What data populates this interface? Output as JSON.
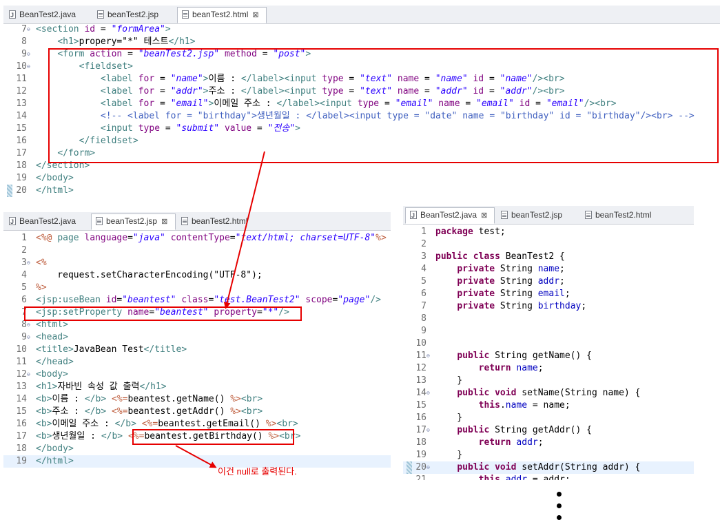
{
  "top_pane": {
    "tabs": [
      {
        "label": "BeanTest2.java",
        "icon": "java-file-icon",
        "active": false
      },
      {
        "label": "beanTest2.jsp",
        "icon": "jsp-file-icon",
        "active": false
      },
      {
        "label": "beanTest2.html",
        "icon": "html-file-icon",
        "active": true
      }
    ],
    "lines": [
      {
        "n": "7",
        "fold": "⊖",
        "html": "<span class='tag'>&lt;section</span> <span class='attr'>id</span> = <span class='str'>\"formArea\"</span><span class='tag'>&gt;</span>"
      },
      {
        "n": "8",
        "html": "    <span class='tag'>&lt;h1&gt;</span>propery=\"*\" 테스트<span class='tag'>&lt;/h1&gt;</span>"
      },
      {
        "n": "9",
        "fold": "⊖",
        "html": "    <span class='tag'>&lt;form</span> <span class='attr'>action</span> = <span class='str'>\"beanTest2.jsp\"</span> <span class='attr'>method</span> = <span class='str'>\"post\"</span><span class='tag'>&gt;</span>"
      },
      {
        "n": "10",
        "fold": "⊖",
        "html": "        <span class='tag'>&lt;fieldset&gt;</span>"
      },
      {
        "n": "11",
        "html": "            <span class='tag'>&lt;label</span> <span class='attr'>for</span> = <span class='str'>\"name\"</span><span class='tag'>&gt;</span>이름 : <span class='tag'>&lt;/label&gt;&lt;input</span> <span class='attr'>type</span> = <span class='str'>\"text\"</span> <span class='attr'>name</span> = <span class='str'>\"name\"</span> <span class='attr'>id</span> = <span class='str'>\"name\"</span><span class='tag'>/&gt;&lt;br&gt;</span>"
      },
      {
        "n": "12",
        "html": "            <span class='tag'>&lt;label</span> <span class='attr'>for</span> = <span class='str'>\"addr\"</span><span class='tag'>&gt;</span>주소 : <span class='tag'>&lt;/label&gt;&lt;input</span> <span class='attr'>type</span> = <span class='str'>\"text\"</span> <span class='attr'>name</span> = <span class='str'>\"addr\"</span> <span class='attr'>id</span> = <span class='str'>\"addr\"</span><span class='tag'>/&gt;&lt;br&gt;</span>"
      },
      {
        "n": "13",
        "html": "            <span class='tag'>&lt;label</span> <span class='attr'>for</span> = <span class='str'>\"email\"</span><span class='tag'>&gt;</span>이메일 주소 : <span class='tag'>&lt;/label&gt;&lt;input</span> <span class='attr'>type</span> = <span class='str'>\"email\"</span> <span class='attr'>name</span> = <span class='str'>\"email\"</span> <span class='attr'>id</span> = <span class='str'>\"email\"</span><span class='tag'>/&gt;&lt;br&gt;</span>"
      },
      {
        "n": "14",
        "html": "            <span class='cmt'>&lt;!-- &lt;label for = \"birthday\"&gt;생년월일 : &lt;/label&gt;&lt;input type = \"date\" name = \"birthday\" id = \"birthday\"/&gt;&lt;br&gt; --&gt;</span>"
      },
      {
        "n": "15",
        "html": "            <span class='tag'>&lt;input</span> <span class='attr'>type</span> = <span class='str'>\"submit\"</span> <span class='attr'>value</span> = <span class='str'>\"전송\"</span><span class='tag'>&gt;</span>"
      },
      {
        "n": "16",
        "html": "        <span class='tag'>&lt;/fieldset&gt;</span>"
      },
      {
        "n": "17",
        "html": "    <span class='tag'>&lt;/form&gt;</span>"
      },
      {
        "n": "18",
        "html": "<span class='tag'>&lt;/section&gt;</span>"
      },
      {
        "n": "19",
        "html": "<span class='tag'>&lt;/body&gt;</span>"
      },
      {
        "n": "20",
        "marker": true,
        "html": "<span class='tag'>&lt;/html&gt;</span>"
      }
    ]
  },
  "jsp_pane": {
    "tabs": [
      {
        "label": "BeanTest2.java",
        "icon": "java-file-icon",
        "active": false
      },
      {
        "label": "beanTest2.jsp",
        "icon": "jsp-file-icon",
        "active": true
      },
      {
        "label": "beanTest2.html",
        "icon": "html-file-icon",
        "active": false
      }
    ],
    "lines": [
      {
        "n": "1",
        "html": "<span class='jsp'>&lt;%@</span> <span class='tag'>page</span> <span class='attr'>language</span>=<span class='str'>\"java\"</span> <span class='attr'>contentType</span>=<span class='str'>\"text/html; charset=UTF-8\"</span><span class='jsp'>%&gt;</span>"
      },
      {
        "n": "2",
        "html": ""
      },
      {
        "n": "3",
        "fold": "⊖",
        "html": "<span class='jsp'>&lt;%</span>"
      },
      {
        "n": "4",
        "html": "    request.setCharacterEncoding(\"UTF-8\");"
      },
      {
        "n": "5",
        "html": "<span class='jsp'>%&gt;</span>"
      },
      {
        "n": "6",
        "html": "<span class='tag'>&lt;jsp:useBean</span> <span class='attr'>id</span>=<span class='str'>\"beantest\"</span> <span class='attr'>class</span>=<span class='str'>\"test.BeanTest2\"</span> <span class='attr'>scope</span>=<span class='str'>\"page\"</span><span class='tag'>/&gt;</span>"
      },
      {
        "n": "7",
        "html": "<span class='tag'>&lt;jsp:setProperty</span> <span class='attr'>name</span>=<span class='str'>\"beantest\"</span> <span class='attr'>property</span>=<span class='str'>\"*\"</span><span class='tag'>/&gt;</span>"
      },
      {
        "n": "8",
        "fold": "⊖",
        "html": "<span class='tag'>&lt;html&gt;</span>"
      },
      {
        "n": "9",
        "fold": "⊖",
        "html": "<span class='tag'>&lt;head&gt;</span>"
      },
      {
        "n": "10",
        "html": "<span class='tag'>&lt;title&gt;</span>JavaBean Test<span class='tag'>&lt;/title&gt;</span>"
      },
      {
        "n": "11",
        "html": "<span class='tag'>&lt;/head&gt;</span>"
      },
      {
        "n": "12",
        "fold": "⊖",
        "html": "<span class='tag'>&lt;body&gt;</span>"
      },
      {
        "n": "13",
        "html": "<span class='tag'>&lt;h1&gt;</span>자바빈 속성 값 출력<span class='tag'>&lt;/h1&gt;</span>"
      },
      {
        "n": "14",
        "html": "<span class='tag'>&lt;b&gt;</span>이름 : <span class='tag'>&lt;/b&gt;</span> <span class='jsp'>&lt;%=</span>beantest.getName() <span class='jsp'>%&gt;</span><span class='tag'>&lt;br&gt;</span>"
      },
      {
        "n": "15",
        "html": "<span class='tag'>&lt;b&gt;</span>주소 : <span class='tag'>&lt;/b&gt;</span> <span class='jsp'>&lt;%=</span>beantest.getAddr() <span class='jsp'>%&gt;</span><span class='tag'>&lt;br&gt;</span>"
      },
      {
        "n": "16",
        "html": "<span class='tag'>&lt;b&gt;</span>이메일 주소 : <span class='tag'>&lt;/b&gt;</span> <span class='jsp'>&lt;%=</span>beantest.getEmail() <span class='jsp'>%&gt;</span><span class='tag'>&lt;br&gt;</span>"
      },
      {
        "n": "17",
        "html": "<span class='tag'>&lt;b&gt;</span>생년월일 : <span class='tag'>&lt;/b&gt;</span> <span class='jsp'>&lt;%=</span>beantest.getBirthday() <span class='jsp'>%&gt;</span><span class='tag'>&lt;br&gt;</span>"
      },
      {
        "n": "18",
        "html": "<span class='tag'>&lt;/body&gt;</span>"
      },
      {
        "n": "19",
        "hl": true,
        "html": "<span class='tag'>&lt;/html&gt;</span>"
      }
    ]
  },
  "java_pane": {
    "tabs": [
      {
        "label": "BeanTest2.java",
        "icon": "java-file-icon",
        "active": true
      },
      {
        "label": "beanTest2.jsp",
        "icon": "jsp-file-icon",
        "active": false
      },
      {
        "label": "beanTest2.html",
        "icon": "html-file-icon",
        "active": false
      }
    ],
    "lines": [
      {
        "n": "1",
        "html": "<span class='kw'>package</span> test;"
      },
      {
        "n": "2",
        "html": ""
      },
      {
        "n": "3",
        "html": "<span class='kw'>public</span> <span class='kw'>class</span> BeanTest2 {"
      },
      {
        "n": "4",
        "html": "    <span class='kw'>private</span> String <span class='fld'>name</span>;"
      },
      {
        "n": "5",
        "html": "    <span class='kw'>private</span> String <span class='fld'>addr</span>;"
      },
      {
        "n": "6",
        "html": "    <span class='kw'>private</span> String <span class='fld'>email</span>;"
      },
      {
        "n": "7",
        "html": "    <span class='kw'>private</span> String <span class='fld'>birthday</span>;"
      },
      {
        "n": "8",
        "html": ""
      },
      {
        "n": "9",
        "html": ""
      },
      {
        "n": "10",
        "html": ""
      },
      {
        "n": "11",
        "fold": "⊖",
        "html": "    <span class='kw'>public</span> String getName() {"
      },
      {
        "n": "12",
        "html": "        <span class='kw'>return</span> <span class='fld'>name</span>;"
      },
      {
        "n": "13",
        "html": "    }"
      },
      {
        "n": "14",
        "fold": "⊖",
        "html": "    <span class='kw'>public</span> <span class='kw'>void</span> setName(String name) {"
      },
      {
        "n": "15",
        "html": "        <span class='kw'>this</span>.<span class='fld'>name</span> = name;"
      },
      {
        "n": "16",
        "html": "    }"
      },
      {
        "n": "17",
        "fold": "⊖",
        "html": "    <span class='kw'>public</span> String getAddr() {"
      },
      {
        "n": "18",
        "html": "        <span class='kw'>return</span> <span class='fld'>addr</span>;"
      },
      {
        "n": "19",
        "html": "    }"
      },
      {
        "n": "20",
        "fold": "⊖",
        "marker": true,
        "hl": true,
        "html": "    <span class='kw'>public</span> <span class='kw'>void</span> setAddr(String addr) {"
      },
      {
        "n": "21",
        "html": "        <span class='kw'>this</span>.<span class='fld'>addr</span> = addr;"
      }
    ]
  },
  "annotation": {
    "note": "이건 null로 출력된다.",
    "color": "#e60000"
  }
}
